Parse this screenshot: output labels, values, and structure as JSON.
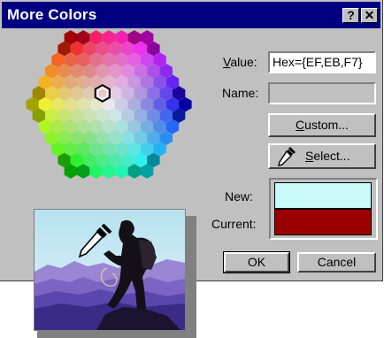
{
  "window": {
    "title": "More Colors",
    "help_button": "?",
    "close_button": "✕"
  },
  "value_field": {
    "label_underlined": "V",
    "label_rest": "alue:",
    "value": "Hex={EF,EB,F7}"
  },
  "name_field": {
    "label": "Name:",
    "value": ""
  },
  "buttons": {
    "custom_underlined": "C",
    "custom_rest": "ustom...",
    "select_underlined": "S",
    "select_rest": "elect...",
    "ok": "OK",
    "cancel": "Cancel"
  },
  "preview": {
    "new_label": "New:",
    "current_label": "Current:",
    "new_color": "#C8FAFA",
    "current_color": "#9A0000"
  },
  "colors": {
    "title_bar": "#000080",
    "dialog_face": "#C0C0C0"
  },
  "icons": {
    "eyedropper": "eyedropper-icon",
    "selection_hex": "selected-hexagon-outline"
  }
}
